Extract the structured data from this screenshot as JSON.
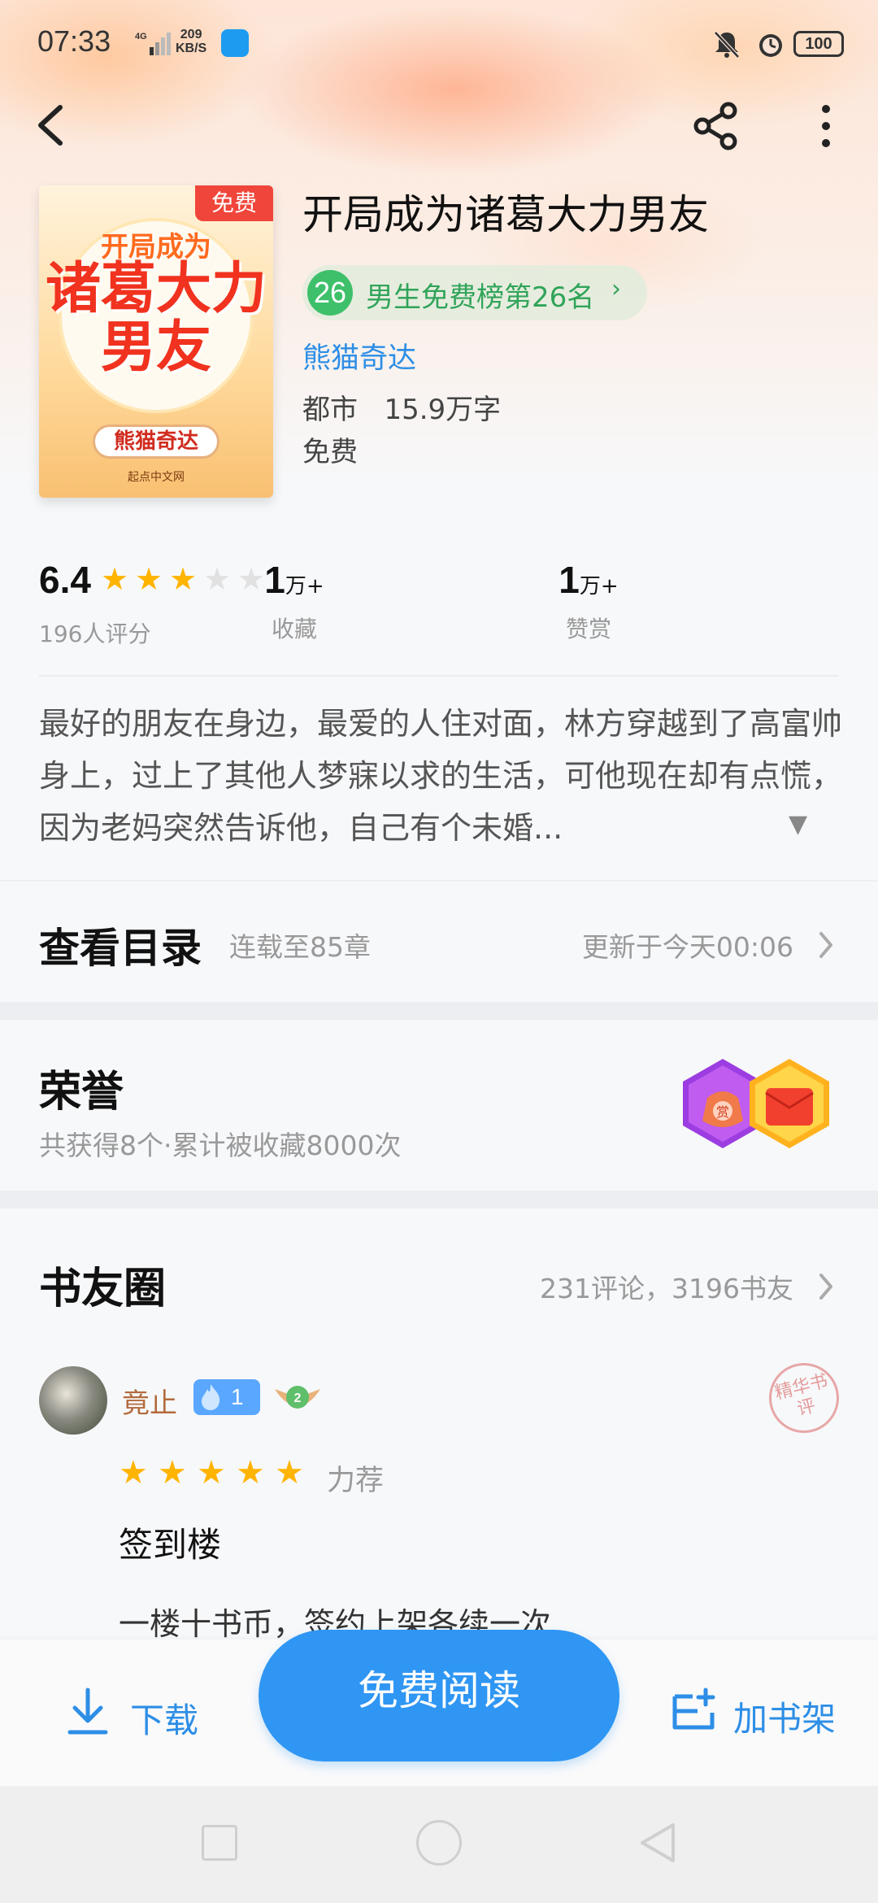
{
  "status": {
    "time": "07:33",
    "network": "4G",
    "speed_value": "209",
    "speed_unit": "KB/S",
    "battery": "100"
  },
  "header": {
    "back_icon": "chevron-left-icon",
    "share_icon": "share-icon",
    "more_icon": "more-vertical-icon"
  },
  "book": {
    "cover": {
      "free_tag": "免费",
      "title_line1": "开局成为",
      "title_line2": "诸葛大力",
      "title_line3": "男友",
      "author": "熊猫奇达",
      "publisher": "起点中文网"
    },
    "title": "开局成为诸葛大力男友",
    "rank": {
      "number": "26",
      "label": "男生免费榜第26名"
    },
    "author": "熊猫奇达",
    "category": "都市",
    "word_count": "15.9万字",
    "price": "免费"
  },
  "stats": {
    "score": "6.4",
    "stars_filled": 3,
    "stars_total": 5,
    "rating_count": "196人评分",
    "favorites_num": "1",
    "favorites_unit": "万+",
    "favorites_label": "收藏",
    "rewards_num": "1",
    "rewards_unit": "万+",
    "rewards_label": "赞赏"
  },
  "synopsis": "最好的朋友在身边，最爱的人住对面，林方穿越到了高富帅身上，过上了其他人梦寐以求的生活，可他现在却有点慌，因为老妈突然告诉他，自己有个未婚...",
  "catalog": {
    "title": "查看目录",
    "progress": "连载至85章",
    "update": "更新于今天00:06"
  },
  "honor": {
    "title": "荣誉",
    "subtitle": "共获得8个·累计被收藏8000次",
    "badge1_text": "赏"
  },
  "circle": {
    "title": "书友圈",
    "counts": "231评论，3196书友",
    "review": {
      "username": "竟止",
      "fan_level": "1",
      "user_level": "2",
      "stamp": "精华书评",
      "stars": 5,
      "tag": "力荐",
      "title": "签到楼",
      "body": "一楼十书币，签约上架各续一次"
    }
  },
  "bottom_bar": {
    "download_label": "下载",
    "read_label": "免费阅读",
    "shelf_label": "加书架"
  },
  "colors": {
    "accent": "#2f96f3",
    "rank_green": "#3ec06b",
    "star": "#ffb400",
    "free_tag": "#f0453a"
  }
}
